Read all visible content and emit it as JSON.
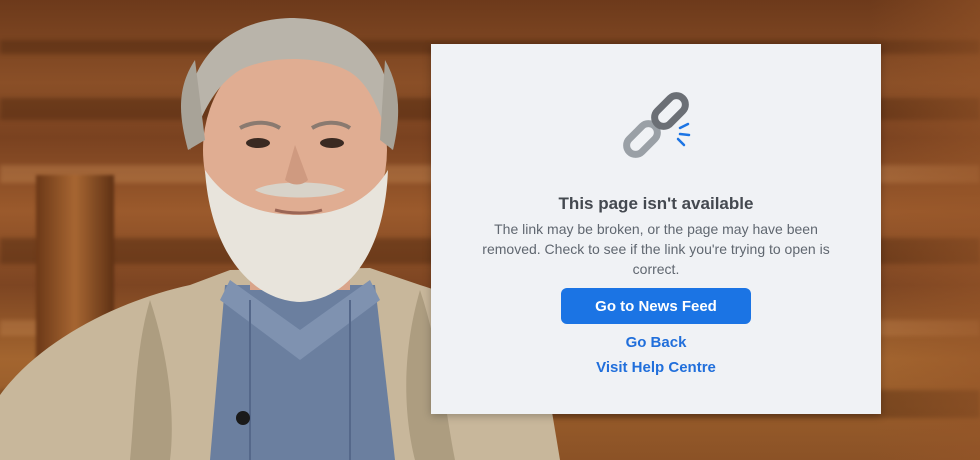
{
  "background": {
    "description_icon": "photo-background",
    "colors": {
      "wood": "#8a4f27",
      "jacket": "#c8b79b",
      "shirt": "#6b7f9f",
      "beard": "#e8e4dc"
    }
  },
  "dialog": {
    "icon": "broken-link-icon",
    "title": "This page isn't available",
    "description": "The link may be broken, or the page may have been removed. Check to see if the link you're trying to open is correct.",
    "primary_button": "Go to News Feed",
    "links": {
      "back": "Go Back",
      "help": "Visit Help Centre"
    },
    "colors": {
      "card_bg": "#f0f2f5",
      "button_bg": "#1b74e4",
      "link": "#216fdb",
      "title": "#444950",
      "text": "#606770"
    }
  }
}
